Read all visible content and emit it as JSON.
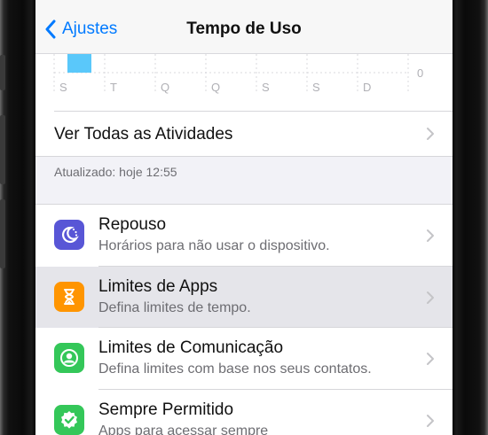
{
  "nav": {
    "back_label": "Ajustes",
    "title": "Tempo de Uso"
  },
  "chart_data": {
    "type": "bar",
    "categories": [
      "S",
      "T",
      "Q",
      "Q",
      "S",
      "S",
      "D"
    ],
    "values": [
      1,
      0,
      0,
      0,
      0,
      0,
      0
    ],
    "ylim": [
      0,
      1
    ],
    "ytick_zero_label": "0",
    "bar_color": "#5ac8fa",
    "grid": "dotted vertical"
  },
  "activities_row": {
    "label": "Ver Todas as Atividades"
  },
  "updated_text": "Atualizado: hoje 12:55",
  "settings": [
    {
      "title": "Repouso",
      "subtitle": "Horários para não usar o dispositivo.",
      "icon": "moon-icon",
      "color": "#5856d6",
      "highlighted": false
    },
    {
      "title": "Limites de Apps",
      "subtitle": "Defina limites de tempo.",
      "icon": "hourglass-icon",
      "color": "#ff9500",
      "highlighted": true
    },
    {
      "title": "Limites de Comunicação",
      "subtitle": "Defina limites com base nos seus contatos.",
      "icon": "contact-icon",
      "color": "#34c759",
      "highlighted": false
    },
    {
      "title": "Sempre Permitido",
      "subtitle": "Apps para acessar sempre",
      "icon": "checkmark-badge-icon",
      "color": "#34c759",
      "highlighted": false
    }
  ]
}
